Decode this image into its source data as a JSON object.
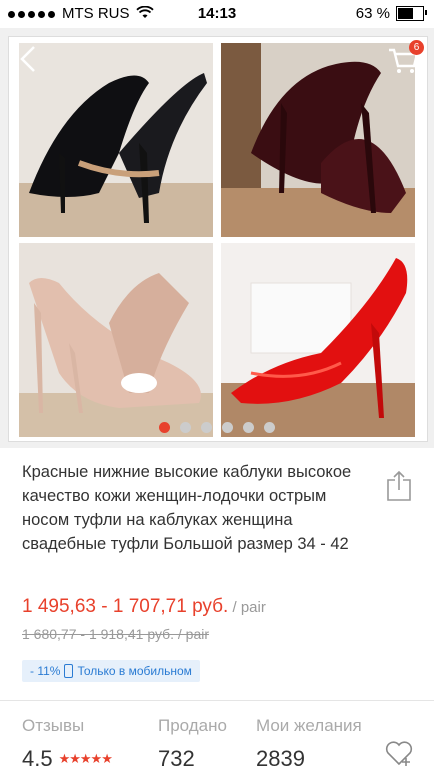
{
  "status_bar": {
    "carrier": "MTS RUS",
    "time": "14:13",
    "battery": "63 %",
    "battery_level": 0.63
  },
  "gallery": {
    "cart_count": "6",
    "page_count": 6,
    "active_page": 0,
    "images": [
      "black-patent-pump-icon",
      "burgundy-patent-pump-icon",
      "nude-patent-pump-icon",
      "red-patent-pump-icon"
    ]
  },
  "product": {
    "title": "Красные нижние высокие каблуки высокое качество кожи женщин-лодочки острым носом туфли на каблуках женщина свадебные туфли Большой размер 34 - 42",
    "price": "1 495,63 - 1 707,71 руб.",
    "price_unit": " / pair",
    "old_price": "1 680,77 - 1 918,41 руб.  / pair",
    "promo_discount": "- 11%",
    "promo_text": "Только в мобильном"
  },
  "stats": {
    "reviews_label": "Отзывы",
    "rating": "4.5",
    "rating_stars": "★★★★★",
    "sold_label": "Продано",
    "sold": "732",
    "wishlist_label": "Мои желания",
    "wishlist": "2839"
  },
  "colors": {
    "accent": "#e8412c",
    "promo_blue": "#2a7bd3"
  }
}
